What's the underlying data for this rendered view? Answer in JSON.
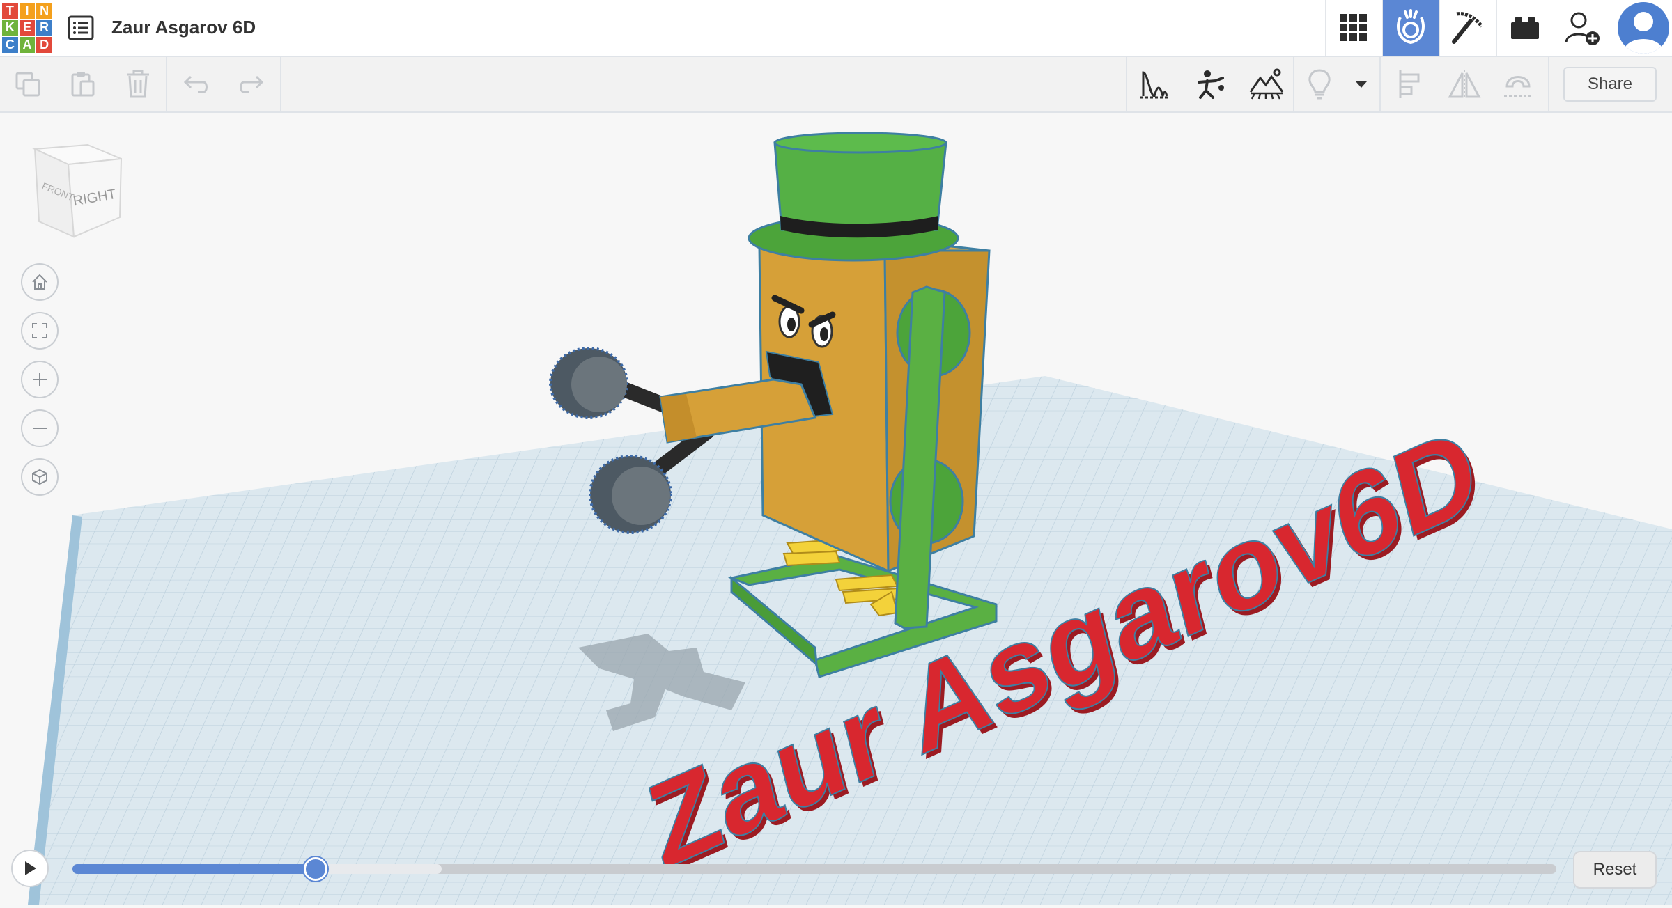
{
  "header": {
    "logo_letters": [
      "T",
      "I",
      "N",
      "K",
      "E",
      "R",
      "C",
      "A",
      "D"
    ],
    "logo_colors": [
      "#e2493b",
      "#f4a01c",
      "#f4a01c",
      "#6fb33b",
      "#e2493b",
      "#3d7fc9",
      "#3d7fc9",
      "#6fb33b",
      "#e2493b"
    ],
    "title": "Zaur Asgarov 6D",
    "apps": [
      {
        "name": "3d-design-grid-icon"
      },
      {
        "name": "sim-lab-icon"
      },
      {
        "name": "blocks-pickaxe-icon"
      },
      {
        "name": "bricks-icon"
      },
      {
        "name": "add-user-icon"
      }
    ]
  },
  "toolbar": {
    "share_label": "Share"
  },
  "viewcube": {
    "front": "FRONT",
    "right": "RIGHT"
  },
  "playback": {
    "progress": 0.164,
    "reset_label": "Reset"
  },
  "scene": {
    "text_object": "Zaur Asgarov6D",
    "colors": {
      "grid": "#d5e3eb",
      "hat": "#4ca43a",
      "body": "#d49a35",
      "frame": "#5ab043",
      "text3d": "#d8272f",
      "accent": "#5b87d4"
    }
  }
}
